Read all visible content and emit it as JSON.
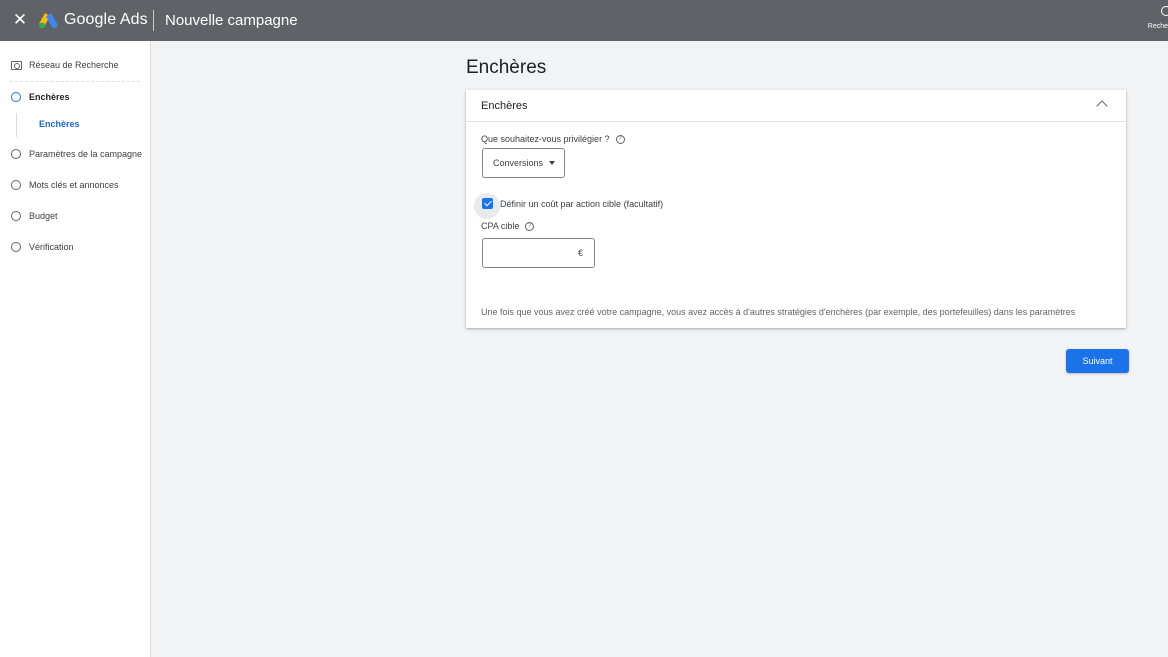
{
  "header": {
    "close_icon": "close-icon",
    "brand": "Google Ads",
    "campaign_title": "Nouvelle campagne",
    "search_label": "Reche"
  },
  "sidebar": {
    "items": [
      {
        "label": "Réseau de Recherche",
        "icon": "search-network-icon"
      },
      {
        "label": "Enchères",
        "active": true
      },
      {
        "label": "Paramètres de la campagne"
      },
      {
        "label": "Mots clés et annonces"
      },
      {
        "label": "Budget"
      },
      {
        "label": "Vérification"
      }
    ],
    "sub_item": "Enchères"
  },
  "main": {
    "page_title": "Enchères",
    "card": {
      "title": "Enchères",
      "question": "Que souhaitez-vous privilégier ?",
      "select_value": "Conversions",
      "checkbox_label": "Définir un coût par action cible (facultatif)",
      "checkbox_checked": true,
      "cpa_label": "CPA cible",
      "cpa_value": "",
      "currency": "€",
      "info": "Une fois que vous avez créé votre campagne, vous avez accès à d'autres stratégies d'enchères (par exemple, des portefeuilles) dans les paramètres"
    },
    "next_label": "Suivant"
  },
  "colors": {
    "header_bg": "#5f6368",
    "accent": "#1a73e8",
    "background": "#f1f3f4"
  }
}
